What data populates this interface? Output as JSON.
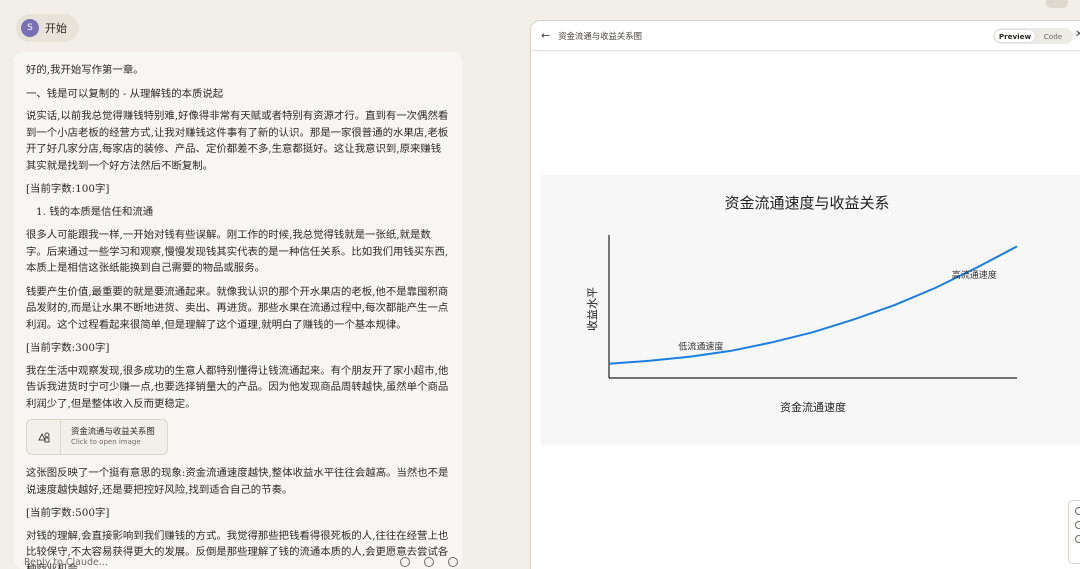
{
  "header": {
    "start_label": "开始",
    "avatar_letter": "S"
  },
  "chat": {
    "paragraphs": {
      "p0": "好的,我开始写作第一章。",
      "p1": "一、钱是可以复制的 - 从理解钱的本质说起",
      "p2": "说实话,以前我总觉得赚钱特别难,好像得非常有天赋或者特别有资源才行。直到有一次偶然看到一个小店老板的经营方式,让我对赚钱这件事有了新的认识。那是一家很普通的水果店,老板开了好几家分店,每家店的装修、产品、定价都差不多,生意都挺好。这让我意识到,原来赚钱其实就是找到一个好方法然后不断复制。",
      "p3": "[当前字数:100字]",
      "p4": "1. 钱的本质是信任和流通",
      "p5": "很多人可能跟我一样,一开始对钱有些误解。刚工作的时候,我总觉得钱就是一张纸,就是数字。后来通过一些学习和观察,慢慢发现钱其实代表的是一种信任关系。比如我们用钱买东西,本质上是相信这张纸能换到自己需要的物品或服务。",
      "p6": "钱要产生价值,最重要的就是要流通起来。就像我认识的那个开水果店的老板,他不是靠囤积商品发财的,而是让水果不断地进货、卖出、再进货。那些水果在流通过程中,每次都能产生一点利润。这个过程看起来很简单,但是理解了这个道理,就明白了赚钱的一个基本规律。",
      "p7": "[当前字数:300字]",
      "p8": "我在生活中观察发现,很多成功的生意人都特别懂得让钱流通起来。有个朋友开了家小超市,他告诉我进货时宁可少赚一点,也要选择销量大的产品。因为他发现商品周转越快,虽然单个商品利润少了,但是整体收入反而更稳定。",
      "p9": "这张图反映了一个挺有意思的现象:资金流通速度越快,整体收益水平往往会越高。当然也不是说速度越快越好,还是要把控好风险,找到适合自己的节奏。",
      "p10": "[当前字数:500字]",
      "p11": "对钱的理解,会直接影响到我们赚钱的方式。我觉得那些把钱看得很死板的人,往往在经营上也比较保守,不太容易获得更大的发展。反倒是那些理解了钱的流通本质的人,会更愿意去尝试各种商业机会。"
    },
    "artifact_card": {
      "title": "资金流通与收益关系图",
      "subtitle": "Click to open image",
      "icon": "image-shapes-icon"
    },
    "reply_placeholder": "Reply to Claude..."
  },
  "panel": {
    "title": "资金流通与收益关系图",
    "toggle_preview": "Preview",
    "toggle_code": "Code",
    "close_icon": "close-icon",
    "back_icon": "back-arrow-icon"
  },
  "chart_data": {
    "type": "line",
    "title": "资金流通速度与收益关系",
    "xlabel": "资金流通速度",
    "ylabel": "收益水平",
    "x": [
      0,
      0.1,
      0.2,
      0.3,
      0.4,
      0.5,
      0.6,
      0.7,
      0.8,
      0.9,
      1.0
    ],
    "series": [
      {
        "values": [
          0.1,
          0.12,
          0.15,
          0.19,
          0.25,
          0.32,
          0.41,
          0.51,
          0.63,
          0.77,
          0.92
        ]
      }
    ],
    "xlim": [
      0,
      1
    ],
    "ylim": [
      0,
      1
    ],
    "show_ticks": false,
    "grid": false,
    "annotations": [
      {
        "text": "低流通速度",
        "x": 0.17,
        "y": 0.2
      },
      {
        "text": "高流通速度",
        "x": 0.84,
        "y": 0.7
      }
    ],
    "line_color": "#1a7fe0"
  }
}
